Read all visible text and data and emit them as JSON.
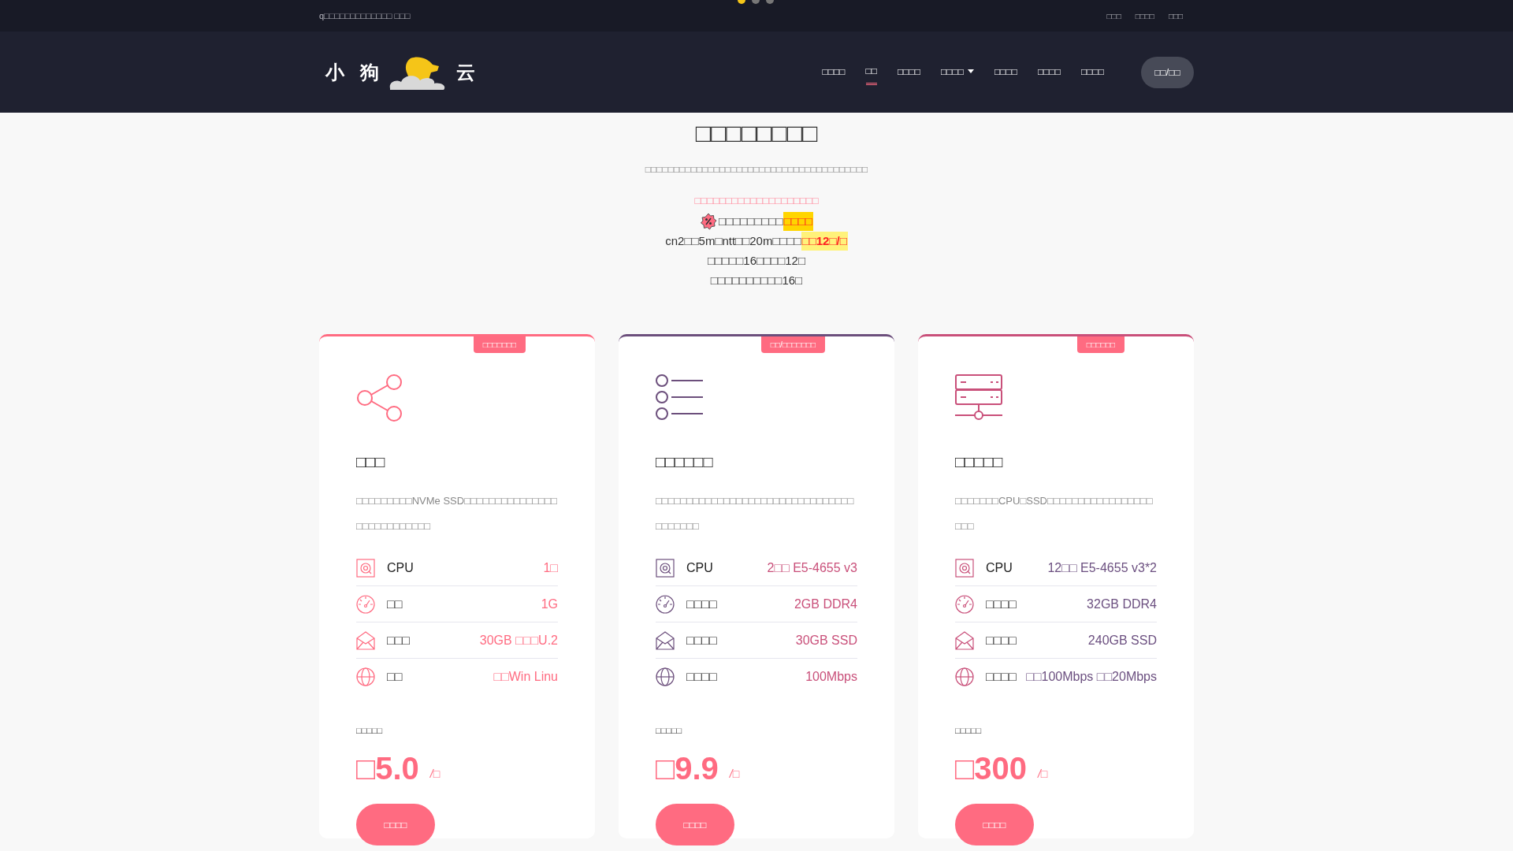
{
  "slider_dots": [
    {
      "selected": true
    },
    {
      "selected": false
    },
    {
      "selected": false
    }
  ],
  "top_bar": {
    "notice": "q□□□□□□□□□□□□□ □□□",
    "links": [
      "□□□",
      "□□□□",
      "□□□"
    ]
  },
  "logo": {
    "left": "小 狗",
    "right": "云"
  },
  "nav": {
    "items": [
      {
        "label": "□□□□",
        "selected": false,
        "dropdown": false
      },
      {
        "label": "□□",
        "selected": true,
        "dropdown": false
      },
      {
        "label": "□□□□",
        "selected": false,
        "dropdown": false
      },
      {
        "label": "□□□□",
        "selected": false,
        "dropdown": true
      },
      {
        "label": "□□□□",
        "selected": false,
        "dropdown": false
      },
      {
        "label": "□□□□",
        "selected": false,
        "dropdown": false
      },
      {
        "label": "□□□□",
        "selected": false,
        "dropdown": false
      }
    ],
    "login_button": "□□/□□"
  },
  "intro": {
    "heading": "□□□□□□□□",
    "subtitle": "□□□□□□□□□□□□□□□□□□□□□□□□□□□□□□□□□□□□□□□",
    "promo": "□□□□□□□□□□□□□□□□□□□□",
    "lines": [
      {
        "text": "□□□□□□□□□",
        "highlight": "□□□□",
        "badge": true
      },
      {
        "text": "cn2□□5m□ntt□□20m□□□□",
        "highlight": "□□**12**□/□",
        "badge": false
      },
      {
        "text": "□□□□□16□□□□12□",
        "badge": false
      },
      {
        "text": "□□□□□□□□□□16□",
        "badge": false
      }
    ]
  },
  "plans": [
    {
      "ribbon": "□□□□□□□",
      "color": "#ff6b81",
      "title": "□□□",
      "description": "□□□□□□□□□NVMe SSD□□□□□□□□□□□□□□□□□□□□□□□□□□□",
      "specs": [
        {
          "label": "CPU",
          "value": "1□",
          "color": "#ff6b81"
        },
        {
          "label": "□□",
          "value": "1G",
          "color": "#ff6b81"
        },
        {
          "label": "□□□",
          "value": "30GB □□□U.2",
          "color": "#ff6b81"
        },
        {
          "label": "□□",
          "value": "□□Win Linu",
          "color": "#ff6b81"
        }
      ],
      "price_label": "□□□□□",
      "price": "□5.0",
      "unit": "/□",
      "button": "□□□□"
    },
    {
      "ribbon": "□□/□□□□□□□",
      "color": "#6c4f7c",
      "title": "□□□□□□",
      "description": "□□□□□□□□□□□□□□□□□□□□□□□□□□□□□□□□□□□□□□□",
      "specs": [
        {
          "label": "CPU",
          "value": "2□□ E5-4655 v3",
          "color": "#c9507a"
        },
        {
          "label": "□□□□",
          "value": "2GB DDR4",
          "color": "#c9507a"
        },
        {
          "label": "□□□□",
          "value": "30GB SSD",
          "color": "#c9507a"
        },
        {
          "label": "□□□□",
          "value": "100Mbps",
          "color": "#c9507a"
        }
      ],
      "price_label": "□□□□□",
      "price": "□9.9",
      "unit": "/□",
      "button": "□□□□"
    },
    {
      "ribbon": "□□□□□□",
      "color": "#c9507a",
      "title": "□□□□□",
      "description": "□□□□□□□CPU□SSD□□□□□□□□□□□□□□□□□□□□",
      "specs": [
        {
          "label": "CPU",
          "value": "12□□ E5-4655 v3*2",
          "color": "#6c5080"
        },
        {
          "label": "□□□□",
          "value": "32GB DDR4",
          "color": "#6c5080"
        },
        {
          "label": "□□□□",
          "value": "240GB SSD",
          "color": "#6c5080"
        },
        {
          "label": "□□□□",
          "value": "□□100Mbps □□20Mbps",
          "color": "#6c5080"
        }
      ],
      "price_label": "□□□□□",
      "price": "□300",
      "unit": "/□",
      "button": "□□□□"
    }
  ]
}
